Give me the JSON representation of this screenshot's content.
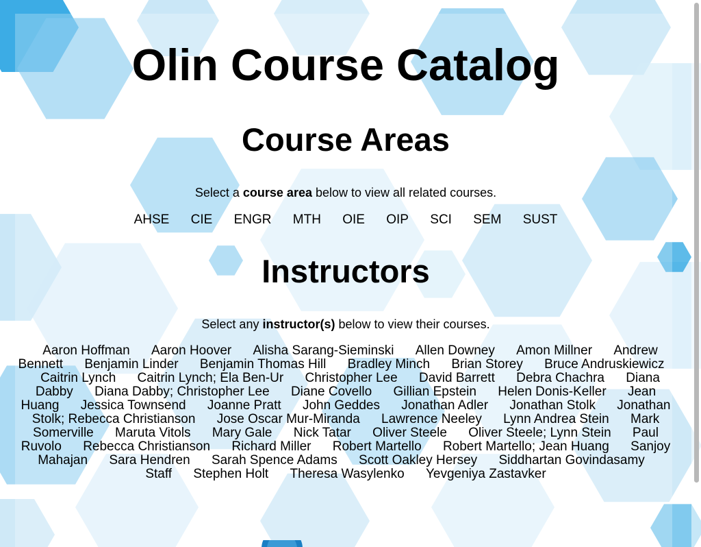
{
  "header": {
    "title": "Olin Course Catalog"
  },
  "course_areas": {
    "heading": "Course Areas",
    "intro_prefix": "Select a ",
    "intro_bold": "course area",
    "intro_suffix": " below to view all related courses.",
    "items": [
      "AHSE",
      "CIE",
      "ENGR",
      "MTH",
      "OIE",
      "OIP",
      "SCI",
      "SEM",
      "SUST"
    ]
  },
  "instructors": {
    "heading": "Instructors",
    "intro_prefix": "Select any ",
    "intro_bold": "instructor(s)",
    "intro_suffix": " below to view their courses.",
    "items": [
      "Aaron Hoffman",
      "Aaron Hoover",
      "Alisha Sarang-Sieminski",
      "Allen Downey",
      "Amon Millner",
      "Andrew Bennett",
      "Benjamin Linder",
      "Benjamin Thomas Hill",
      "Bradley Minch",
      "Brian Storey",
      "Bruce Andruskiewicz",
      "Caitrin Lynch",
      "Caitrin Lynch; Ela Ben-Ur",
      "Christopher Lee",
      "David Barrett",
      "Debra Chachra",
      "Diana Dabby",
      "Diana Dabby; Christopher Lee",
      "Diane Covello",
      "Gillian Epstein",
      "Helen Donis-Keller",
      "Jean Huang",
      "Jessica Townsend",
      "Joanne Pratt",
      "John Geddes",
      "Jonathan Adler",
      "Jonathan Stolk",
      "Jonathan Stolk; Rebecca Christianson",
      "Jose Oscar Mur-Miranda",
      "Lawrence Neeley",
      "Lynn Andrea Stein",
      "Mark Somerville",
      "Maruta Vitols",
      "Mary Gale",
      "Nick Tatar",
      "Oliver Steele",
      "Oliver Steele; Lynn Stein",
      "Paul Ruvolo",
      "Rebecca Christianson",
      "Richard Miller",
      "Robert Martello",
      "Robert Martello; Jean Huang",
      "Sanjoy Mahajan",
      "Sara Hendren",
      "Sarah Spence Adams",
      "Scott Oakley Hersey",
      "Siddhartan Govindasamy",
      "Staff",
      "Stephen Holt",
      "Theresa Wasylenko",
      "Yevgeniya Zastavker"
    ]
  },
  "colors": {
    "hex_light": "#9fd4f0",
    "hex_mid": "#5ab8ea",
    "hex_dark": "#1a9ee0",
    "hex_pale": "#c6e6f7",
    "text": "#000000"
  }
}
